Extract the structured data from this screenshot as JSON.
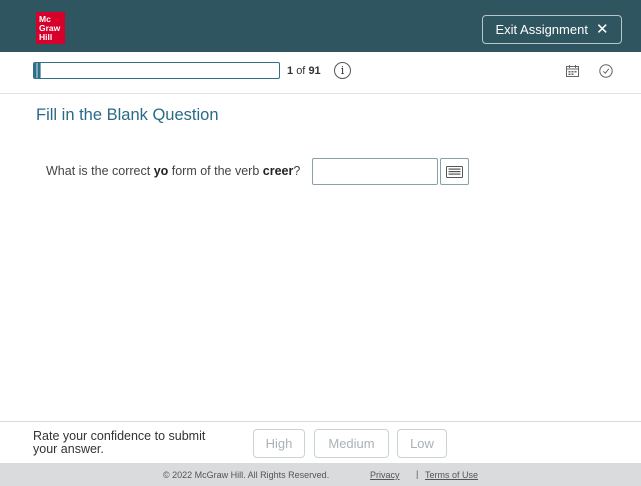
{
  "header": {
    "logo_lines": [
      "Mc",
      "Graw",
      "Hill"
    ],
    "exit_label": "Exit Assignment",
    "exit_icon": "close-icon",
    "brand_color": "#2f5560",
    "logo_color": "#d6002a"
  },
  "toolbar": {
    "progress_current": "1",
    "progress_of": "of",
    "progress_total": "91",
    "progress_fraction": 0.03,
    "info_icon": "info-icon",
    "calendar_icon": "calendar-icon",
    "timer_icon": "clock-icon"
  },
  "question": {
    "title": "Fill in the Blank Question",
    "prompt_prefix": "What is the correct ",
    "prompt_bold1": "yo",
    "prompt_middle": " form of the verb ",
    "prompt_bold2": "creer",
    "prompt_suffix": "?",
    "answer_value": "",
    "keyboard_icon": "keyboard-icon",
    "title_color": "#2a6a86"
  },
  "confidence": {
    "label": "Rate your confidence to submit your answer.",
    "buttons": [
      "High",
      "Medium",
      "Low"
    ]
  },
  "footer": {
    "copyright": "© 2022 McGraw Hill. All Rights Reserved.",
    "privacy": "Privacy",
    "separator": "|",
    "terms": "Terms of Use"
  }
}
